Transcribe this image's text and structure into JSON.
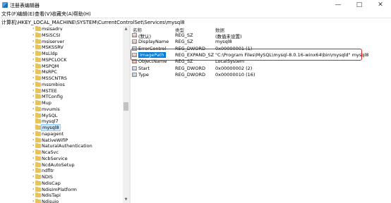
{
  "window": {
    "title": "注册表编辑器",
    "buttons": {
      "minimize": "—",
      "maximize": "□",
      "close": "✕"
    }
  },
  "menu": [
    "文件(F)",
    "编辑(E)",
    "查看(V)",
    "收藏夹(A)",
    "帮助(H)"
  ],
  "address": "计算机\\HKEY_LOCAL_MACHINE\\SYSTEM\\CurrentControlSet\\Services\\mysql8",
  "tree": {
    "items": [
      {
        "label": "msisadrv",
        "arrow": "›"
      },
      {
        "label": "MSiSCSI",
        "arrow": "›"
      },
      {
        "label": "msiserver",
        "arrow": "›"
      },
      {
        "label": "MSKSSRV",
        "arrow": "›"
      },
      {
        "label": "MsLldp",
        "arrow": "›"
      },
      {
        "label": "MSPCLOCK",
        "arrow": "›"
      },
      {
        "label": "MSPQM",
        "arrow": "›"
      },
      {
        "label": "MsRPC",
        "arrow": "›"
      },
      {
        "label": "MSSCNTRS",
        "arrow": "›"
      },
      {
        "label": "mssmbios",
        "arrow": "›"
      },
      {
        "label": "MSTEE",
        "arrow": "›"
      },
      {
        "label": "MTConfig",
        "arrow": "›"
      },
      {
        "label": "Mup",
        "arrow": "›"
      },
      {
        "label": "mvumis",
        "arrow": "›"
      },
      {
        "label": "MySQL",
        "arrow": "›"
      },
      {
        "label": "mysql7",
        "arrow": ""
      },
      {
        "label": "mysql8",
        "arrow": "",
        "selected": true
      },
      {
        "label": "napagent",
        "arrow": "›"
      },
      {
        "label": "NativeWifiP",
        "arrow": "›"
      },
      {
        "label": "NaturalAuthentication",
        "arrow": "›"
      },
      {
        "label": "NcaSvc",
        "arrow": "›"
      },
      {
        "label": "NcbService",
        "arrow": "›"
      },
      {
        "label": "NcdAutoSetup",
        "arrow": "›"
      },
      {
        "label": "ndfltr",
        "arrow": "›"
      },
      {
        "label": "NDIS",
        "arrow": "›"
      },
      {
        "label": "NdisCap",
        "arrow": "›"
      },
      {
        "label": "NdisImPlatform",
        "arrow": "›"
      },
      {
        "label": "NdisTapi",
        "arrow": "›"
      },
      {
        "label": "Ndisuio",
        "arrow": "›"
      }
    ]
  },
  "detail": {
    "headers": {
      "name": "名称",
      "type": "类型",
      "data": "数据"
    },
    "rows": [
      {
        "icon": "ab",
        "name": "(默认)",
        "type": "REG_SZ",
        "data": "(数值未设置)"
      },
      {
        "icon": "ab",
        "name": "DisplayName",
        "type": "REG_SZ",
        "data": "mysql8"
      },
      {
        "icon": "01",
        "name": "ErrorControl",
        "type": "REG_DWORD",
        "data": "0x00000001 (1)"
      },
      {
        "icon": "ab",
        "name": "ImagePath",
        "type": "REG_EXPAND_SZ",
        "data": "\"C:\\Program Files\\MySQL\\mysql-8.0.16-winx64\\bin\\mysqld\" mysql8",
        "highlight": true
      },
      {
        "icon": "ab",
        "name": "ObjectName",
        "type": "REG_SZ",
        "data": "LocalSystem"
      },
      {
        "icon": "01",
        "name": "Start",
        "type": "REG_DWORD",
        "data": "0x00000002 (2)"
      },
      {
        "icon": "01",
        "name": "Type",
        "type": "REG_DWORD",
        "data": "0x00000010 (16)"
      }
    ]
  }
}
